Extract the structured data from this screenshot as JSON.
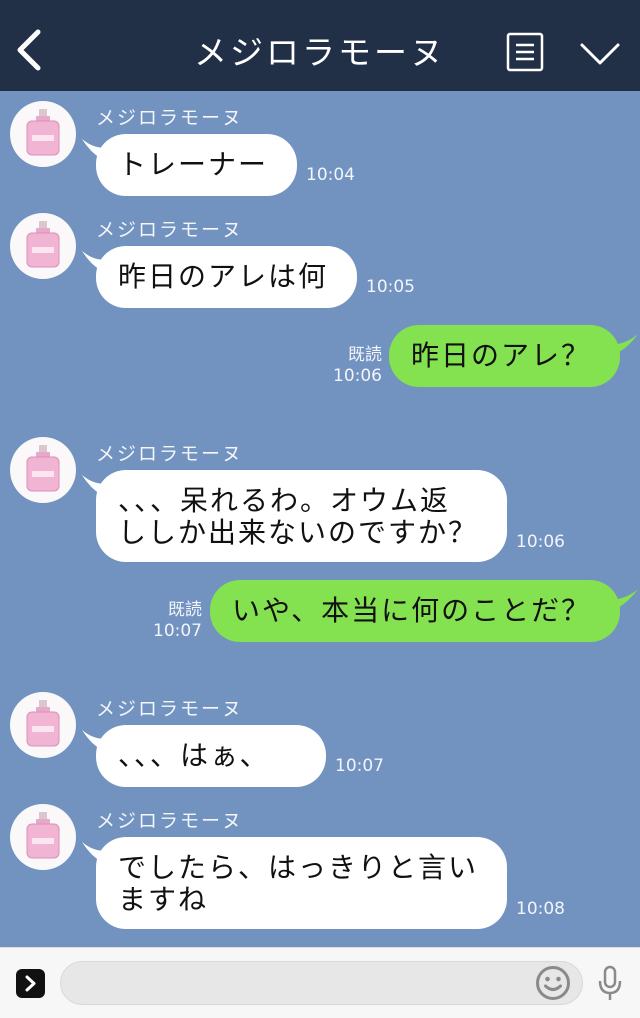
{
  "header": {
    "title": "メジロラモーヌ"
  },
  "colors": {
    "header_bg": "#223047",
    "chat_bg": "#7292c0",
    "incoming_bubble": "#ffffff",
    "outgoing_bubble": "#84e14f"
  },
  "messages": [
    {
      "sender": "メジロラモーヌ",
      "text": "トレーナー",
      "time": "10:04"
    },
    {
      "sender": "メジロラモーヌ",
      "text": "昨日のアレは何",
      "time": "10:05"
    },
    {
      "read": "既読",
      "text": "昨日のアレ？",
      "time": "10:06"
    },
    {
      "sender": "メジロラモーヌ",
      "line1": "、、、呆れるわ。オウム返",
      "line2": "ししか出来ないのですか？",
      "time": "10:06"
    },
    {
      "read": "既読",
      "text": "いや、本当に何のことだ？",
      "time": "10:07"
    },
    {
      "sender": "メジロラモーヌ",
      "text": "、、、はぁ、",
      "time": "10:07"
    },
    {
      "sender": "メジロラモーヌ",
      "line1": "でしたら、はっきりと言い",
      "line2": "ますね",
      "time": "10:08"
    }
  ],
  "footer": {
    "icons": [
      "expand-icon",
      "emoji-icon",
      "microphone-icon"
    ]
  }
}
